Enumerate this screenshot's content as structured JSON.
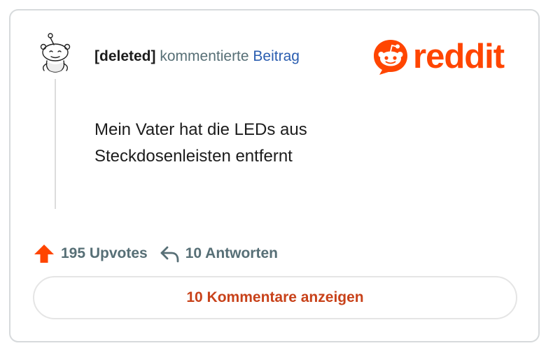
{
  "header": {
    "username": "[deleted]",
    "action": "kommentierte",
    "post_link": "Beitrag"
  },
  "logo": {
    "text": "reddit",
    "icon": "reddit-snoo-icon",
    "color": "#ff4500"
  },
  "comment": {
    "lines": [
      "Mein Vater hat die LEDs aus",
      "Steckdosenleisten entfernt"
    ]
  },
  "stats": {
    "upvotes_icon": "upvote-arrow-icon",
    "upvotes": "195 Upvotes",
    "replies_icon": "reply-arrow-icon",
    "replies": "10 Antworten"
  },
  "button": {
    "label": "10 Kommentare anzeigen"
  },
  "colors": {
    "accent": "#ff4500",
    "link": "#2a5db0",
    "button_text": "#c8421a",
    "muted": "#576f76"
  }
}
